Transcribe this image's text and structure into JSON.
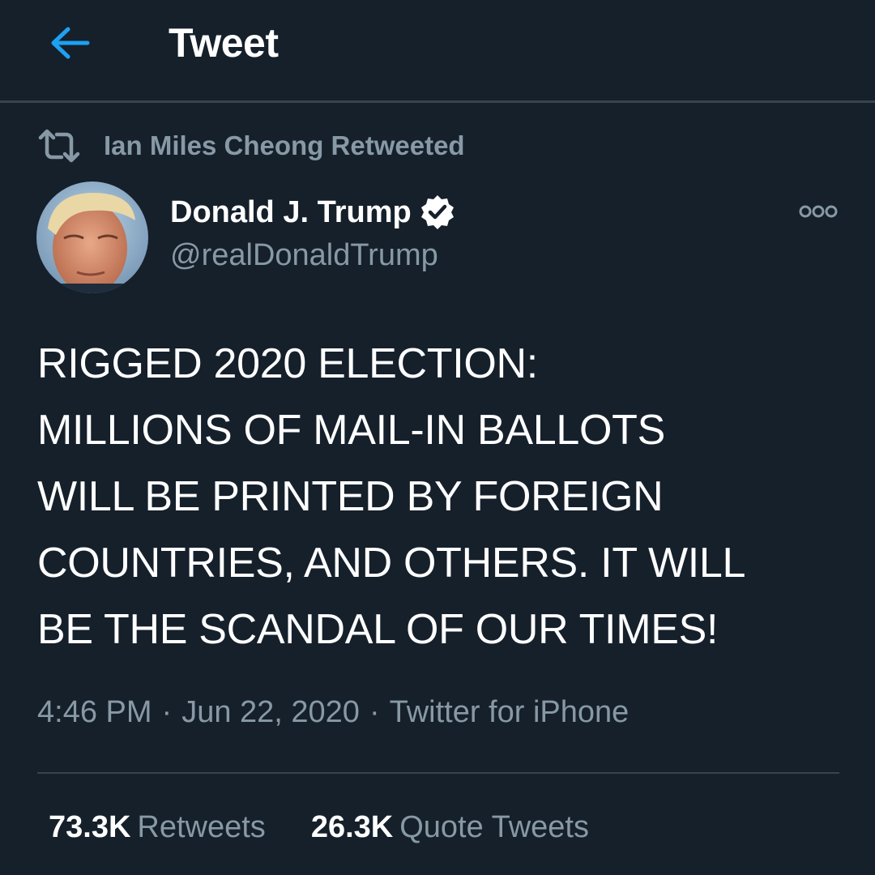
{
  "header": {
    "title": "Tweet"
  },
  "social_context": {
    "text": "Ian Miles Cheong Retweeted"
  },
  "author": {
    "name": "Donald J. Trump",
    "handle": "@realDonaldTrump",
    "verified": true
  },
  "tweet": {
    "text": "RIGGED 2020 ELECTION:\nMILLIONS OF MAIL-IN BALLOTS\nWILL BE PRINTED BY FOREIGN\nCOUNTRIES, AND OTHERS. IT WILL\nBE THE SCANDAL OF OUR TIMES!"
  },
  "meta": {
    "time": "4:46 PM",
    "date": "Jun 22, 2020",
    "source": "Twitter for iPhone",
    "separator": "·"
  },
  "stats": [
    {
      "count": "73.3K",
      "label": "Retweets"
    },
    {
      "count": "26.3K",
      "label": "Quote Tweets"
    }
  ],
  "colors": {
    "background": "#15202b",
    "accent": "#1da1f2",
    "secondary_text": "#8899a6",
    "divider": "#38444d"
  },
  "icons": {
    "back": "arrow-left-icon",
    "retweet": "retweet-icon",
    "verified": "verified-badge-icon",
    "more": "more-options-icon"
  }
}
